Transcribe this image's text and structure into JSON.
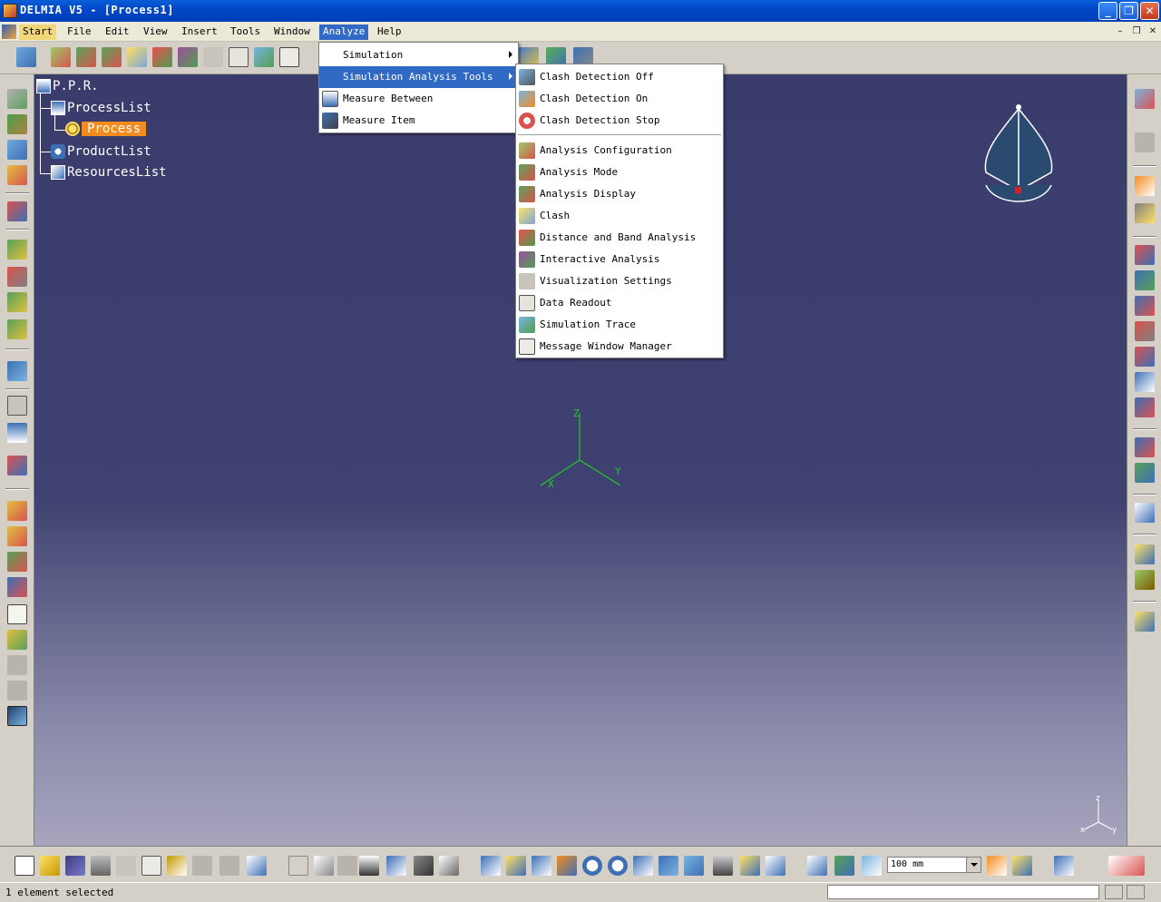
{
  "window": {
    "title": "DELMIA V5 - [Process1]",
    "min": "_",
    "max": "❐",
    "close": "✕"
  },
  "menubar": {
    "items": [
      "Start",
      "File",
      "Edit",
      "View",
      "Insert",
      "Tools",
      "Window",
      "Analyze",
      "Help"
    ],
    "active": "Analyze",
    "mdi_min": "–",
    "mdi_restore": "❐",
    "mdi_close": "✕"
  },
  "tree": {
    "root": "P.P.R.",
    "process_list": "ProcessList",
    "process": "Process",
    "product_list": "ProductList",
    "resources_list": "ResourcesList"
  },
  "analyze_menu": {
    "items": [
      "Simulation",
      "Simulation Analysis Tools",
      "Measure Between",
      "Measure Item"
    ],
    "highlighted": "Simulation Analysis Tools"
  },
  "submenu": {
    "group1": [
      "Clash Detection Off",
      "Clash Detection On",
      "Clash Detection Stop"
    ],
    "group2": [
      "Analysis Configuration",
      "Analysis Mode",
      "Analysis Display",
      "Clash",
      "Distance and Band Analysis",
      "Interactive Analysis",
      "Visualization Settings",
      "Data Readout",
      "Simulation Trace",
      "Message Window Manager"
    ]
  },
  "axes": {
    "z": "Z",
    "x": "X",
    "y": "Y"
  },
  "compass": {
    "z": "z",
    "x": "x",
    "y": "y"
  },
  "toolbar": {
    "unit_value": "100 mm"
  },
  "status": {
    "text": "1 element selected"
  },
  "colors": {
    "viewport_top": "#3a3c6c",
    "viewport_bottom": "#a7a5bd",
    "menu_highlight": "#316ac5",
    "selection": "#f28c1e",
    "axis_green": "#22cc22"
  }
}
